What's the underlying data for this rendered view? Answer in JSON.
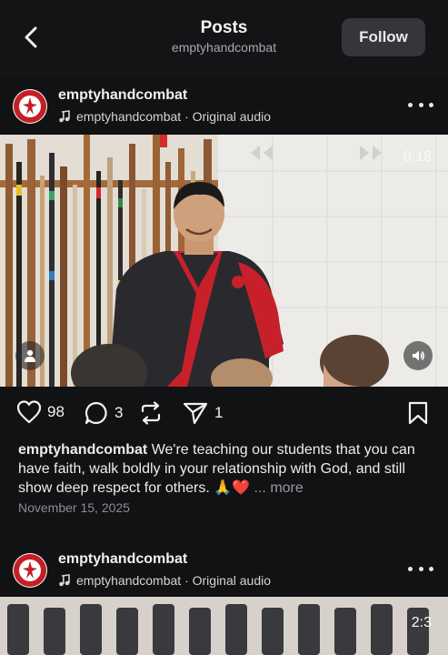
{
  "header": {
    "title": "Posts",
    "subtitle": "emptyhandcombat",
    "follow_label": "Follow"
  },
  "posts": [
    {
      "username": "emptyhandcombat",
      "audio_label": "emptyhandcombat · Original audio",
      "video_time": "0:18",
      "likes": "98",
      "comments": "3",
      "shares": "1",
      "caption_user": "emptyhandcombat",
      "caption_text": " We're teaching our students that you can have faith, walk boldly in your relationship with God, and still show deep respect for others. 🙏❤️",
      "more_label": "... more",
      "date": "November 15, 2025"
    },
    {
      "username": "emptyhandcombat",
      "audio_label": "emptyhandcombat · Original audio",
      "video_time": "2:3"
    }
  ],
  "colors": {
    "background": "#111214",
    "follow_button": "#34363b",
    "uniform_red": "#c8202a",
    "uniform_black": "#2a2a2e"
  },
  "icons": [
    "back-arrow-icon",
    "music-note-icon",
    "more-options-icon",
    "user-tag-icon",
    "volume-icon",
    "heart-icon",
    "comment-icon",
    "repost-icon",
    "send-icon",
    "bookmark-icon"
  ]
}
